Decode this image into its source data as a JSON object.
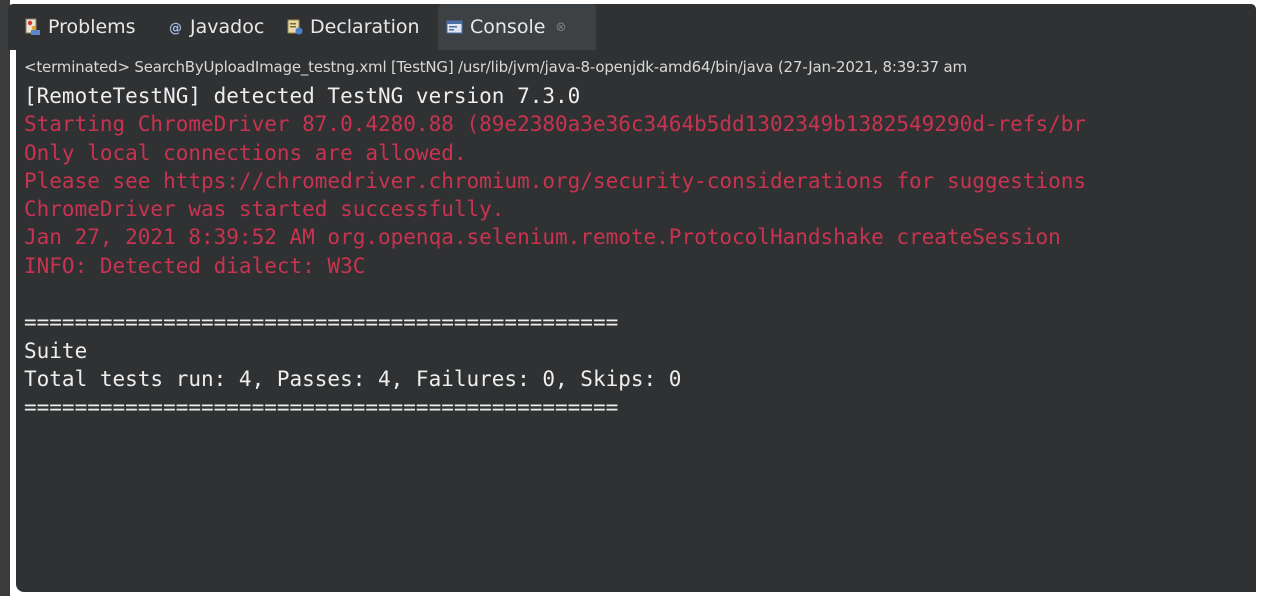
{
  "tabs": [
    {
      "label": "Problems",
      "icon": "problems-icon"
    },
    {
      "label": "Javadoc",
      "icon": "javadoc-icon"
    },
    {
      "label": "Declaration",
      "icon": "declaration-icon"
    },
    {
      "label": "Console",
      "icon": "console-icon",
      "close": "⊗"
    }
  ],
  "colors": {
    "background": "#2f3133",
    "text": "#eeeeee",
    "error": "#c8344f"
  },
  "console": {
    "status": "<terminated> SearchByUploadImage_testng.xml [TestNG] /usr/lib/jvm/java-8-openjdk-amd64/bin/java (27-Jan-2021, 8:39:37 am",
    "lines": [
      {
        "text": "[RemoteTestNG] detected TestNG version 7.3.0",
        "stream": "out"
      },
      {
        "text": "Starting ChromeDriver 87.0.4280.88 (89e2380a3e36c3464b5dd1302349b1382549290d-refs/br",
        "stream": "err"
      },
      {
        "text": "Only local connections are allowed.",
        "stream": "err"
      },
      {
        "text": "Please see https://chromedriver.chromium.org/security-considerations for suggestions",
        "stream": "err"
      },
      {
        "text": "ChromeDriver was started successfully.",
        "stream": "err"
      },
      {
        "text": "Jan 27, 2021 8:39:52 AM org.openqa.selenium.remote.ProtocolHandshake createSession",
        "stream": "err"
      },
      {
        "text": "INFO: Detected dialect: W3C",
        "stream": "err"
      },
      {
        "text": "",
        "stream": "out"
      },
      {
        "text": "===============================================",
        "stream": "out"
      },
      {
        "text": "Suite",
        "stream": "out"
      },
      {
        "text": "Total tests run: 4, Passes: 4, Failures: 0, Skips: 0",
        "stream": "out"
      },
      {
        "text": "===============================================",
        "stream": "out"
      }
    ]
  }
}
